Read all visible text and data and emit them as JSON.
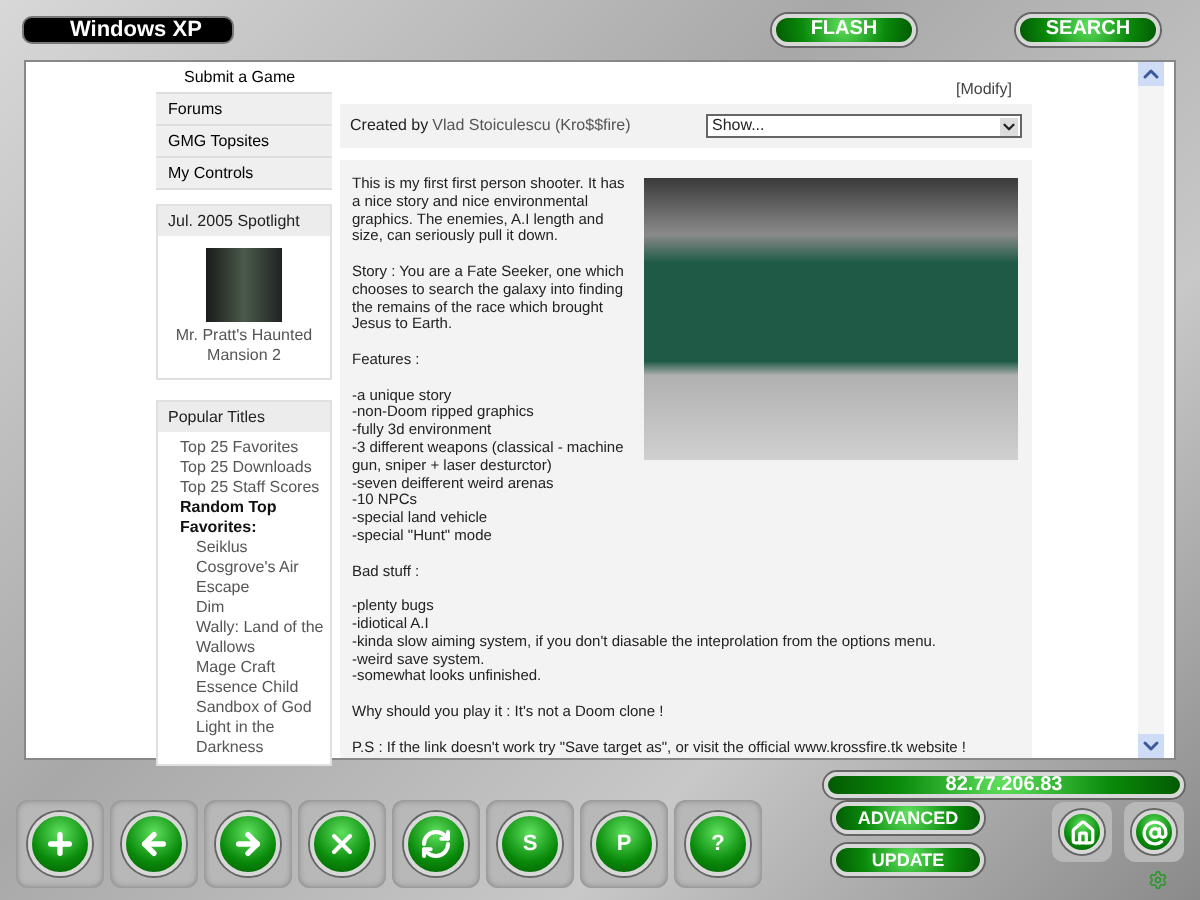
{
  "window": {
    "title": "Windows XP"
  },
  "top_buttons": [
    "FLASH",
    "SEARCH"
  ],
  "sidebar": {
    "menu": [
      {
        "label": "Submit a Game"
      },
      {
        "label": "Forums"
      },
      {
        "label": "GMG Topsites"
      },
      {
        "label": "My Controls"
      }
    ],
    "spotlight": {
      "title": "Jul. 2005 Spotlight",
      "game": "Mr. Pratt's Haunted Mansion 2"
    },
    "popular": {
      "title": "Popular Titles",
      "items": [
        {
          "label": "Top 25 Favorites"
        },
        {
          "label": "Top 25 Downloads"
        },
        {
          "label": "Top 25 Staff Scores"
        },
        {
          "label": "Random Top Favorites:",
          "children": [
            {
              "label": "Seiklus"
            },
            {
              "label": "Cosgrove's Air Escape"
            },
            {
              "label": "Dim"
            },
            {
              "label": "Wally: Land of the Wallows"
            },
            {
              "label": "Mage Craft"
            },
            {
              "label": "Essence Child"
            },
            {
              "label": "Sandbox of God"
            },
            {
              "label": "Light in the Darkness"
            }
          ]
        }
      ]
    }
  },
  "game": {
    "modify_link": "[Modify]",
    "created_by_label": "Created by",
    "author": "Vlad Stoiculescu (Kro$$fire)",
    "select": {
      "value": "Show..."
    },
    "description": [
      {
        "kind": "text",
        "text": "This is my first first person shooter. It has a nice story and nice environmental graphics. The enemies, A.I length and size, can seriously pull it down."
      },
      {
        "kind": "text",
        "text": "Story : You are a Fate Seeker, one which chooses to search the galaxy into finding the remains of the race which brought Jesus to Earth."
      },
      {
        "kind": "text",
        "text": "Features :"
      },
      {
        "kind": "list",
        "items": [
          "-a unique story",
          "-non-Doom ripped graphics",
          "-fully 3d environment",
          "-3 different weapons (classical - machine gun, sniper + laser desturctor)",
          "-seven deifferent weird arenas",
          "-10 NPCs",
          "-special land vehicle",
          "-special \"Hunt\" mode"
        ]
      },
      {
        "kind": "text",
        "text": "Bad stuff :"
      },
      {
        "kind": "list",
        "items": [
          "-plenty bugs",
          "-idiotical A.I",
          "-kinda slow aiming system, if you don't diasable the inteprolation from the options menu.",
          "-weird save system.",
          "-somewhat looks unfinished."
        ]
      },
      {
        "kind": "text",
        "text": "Why should you play it : It's not a Doom clone !"
      },
      {
        "kind": "text",
        "text": "P.S : If the link doesn't work try \"Save target as\", or visit the official www.krossfire.tk website !"
      }
    ]
  },
  "toolbar": [
    {
      "kind": "plus"
    },
    {
      "kind": "back"
    },
    {
      "kind": "forward"
    },
    {
      "kind": "close"
    },
    {
      "kind": "refresh"
    },
    {
      "kind": "letter",
      "text": "S"
    },
    {
      "kind": "letter",
      "text": "P"
    },
    {
      "kind": "letter",
      "text": "?"
    }
  ],
  "ip_address": "82.77.206.83",
  "side_buttons": [
    "ADVANCED",
    "UPDATE"
  ],
  "corner_buttons": [
    {
      "kind": "home"
    },
    {
      "kind": "at"
    }
  ]
}
